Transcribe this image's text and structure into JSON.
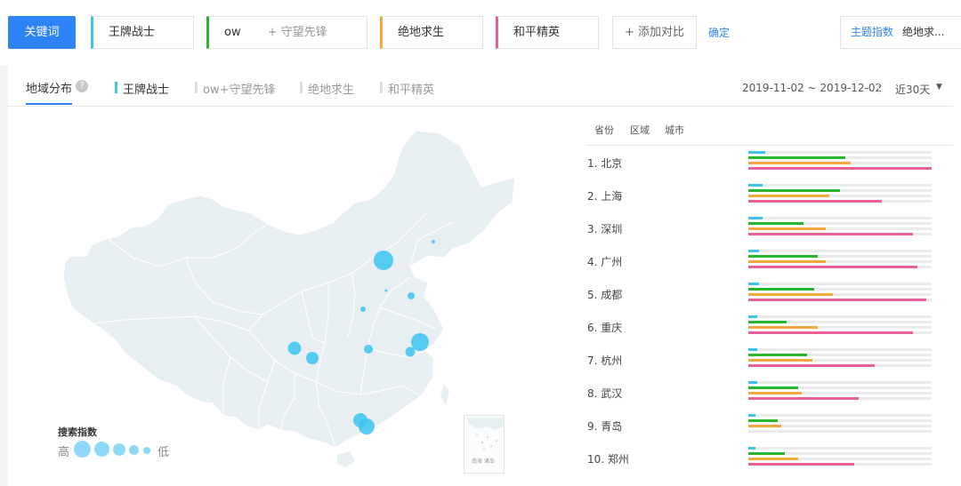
{
  "keyword_bar": {
    "keyword_button": "关键词",
    "keywords": [
      {
        "label": "王牌战士",
        "color": "#3cc4f0"
      },
      {
        "label": "ow",
        "extra": "+ 守望先锋",
        "color": "#2bb52e"
      },
      {
        "label": "绝地求生",
        "color": "#f5a742"
      },
      {
        "label": "和平精英",
        "color": "#e8619a"
      }
    ],
    "add_compare": "+ 添加对比",
    "confirm": "确定",
    "theme_label": "主题指数",
    "theme_value": "绝地求..."
  },
  "panel": {
    "title": "地域分布",
    "help": "?",
    "series_tabs": [
      "王牌战士",
      "ow+守望先锋",
      "绝地求生",
      "和平精英"
    ],
    "date_range": "2019-11-02 ~ 2019-12-02",
    "period": "近30天"
  },
  "map": {
    "legend_title": "搜索指数",
    "legend_high": "高",
    "legend_low": "低",
    "inset_label": "南海 诸岛",
    "fill_color": "#e8eff3",
    "bubble_color": "#3cc4f0"
  },
  "ranking": {
    "tabs": [
      "省份",
      "区域",
      "城市"
    ],
    "series_colors": [
      "#3cc4f0",
      "#2bb52e",
      "#f5a742",
      "#e8619a"
    ],
    "rows": [
      {
        "label": "1.  北京",
        "values": [
          0.09,
          0.53,
          0.56,
          1.0
        ]
      },
      {
        "label": "2.  上海",
        "values": [
          0.08,
          0.5,
          0.44,
          0.73
        ]
      },
      {
        "label": "3.  深圳",
        "values": [
          0.08,
          0.3,
          0.42,
          0.9
        ]
      },
      {
        "label": "4.  广州",
        "values": [
          0.06,
          0.38,
          0.42,
          0.92
        ]
      },
      {
        "label": "5.  成都",
        "values": [
          0.06,
          0.36,
          0.46,
          0.97
        ]
      },
      {
        "label": "6.  重庆",
        "values": [
          0.05,
          0.21,
          0.38,
          0.9
        ]
      },
      {
        "label": "7.  杭州",
        "values": [
          0.05,
          0.32,
          0.35,
          0.69
        ]
      },
      {
        "label": "8.  武汉",
        "values": [
          0.05,
          0.27,
          0.29,
          0.6
        ]
      },
      {
        "label": "9.  青岛",
        "values": [
          0.04,
          0.16,
          0.18,
          0.0
        ]
      },
      {
        "label": "10. 郑州",
        "values": [
          0.04,
          0.2,
          0.27,
          0.58
        ]
      }
    ]
  }
}
